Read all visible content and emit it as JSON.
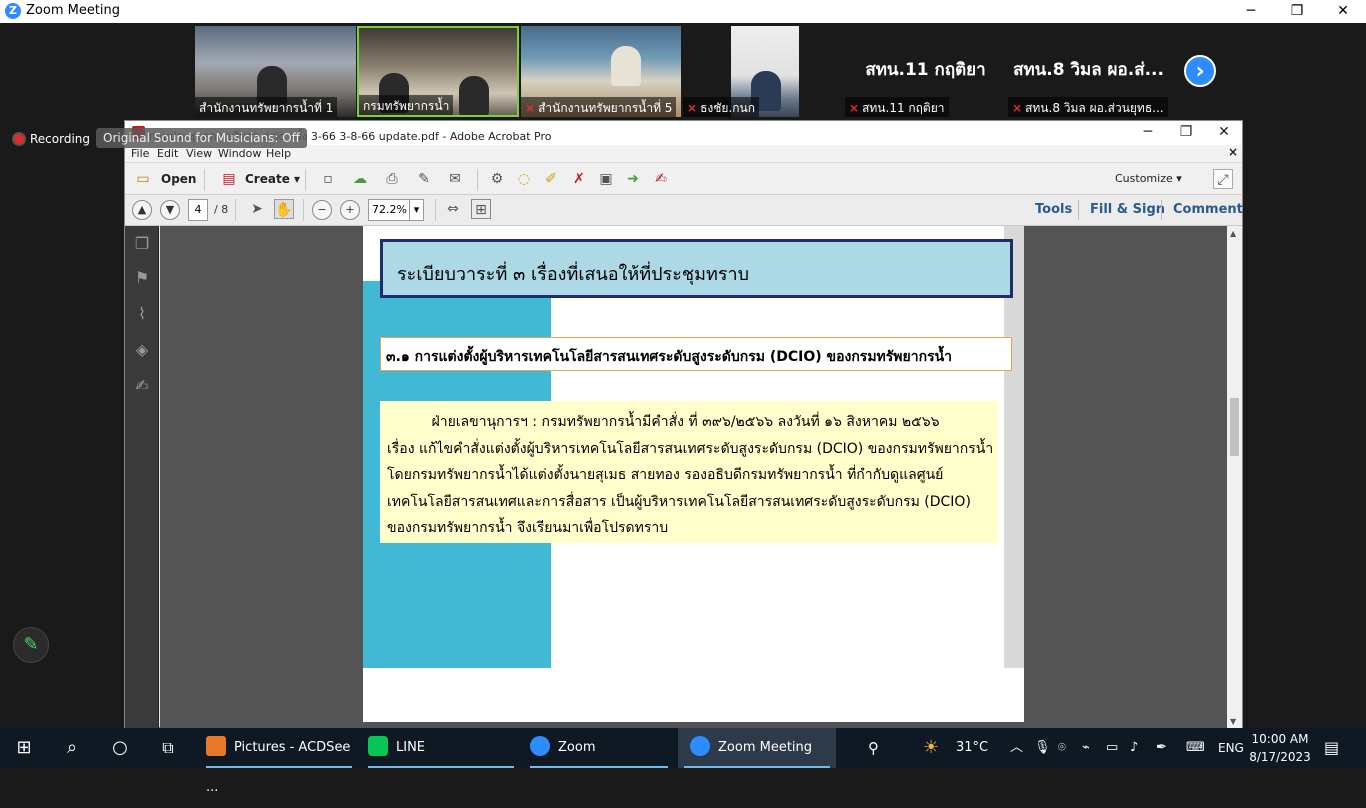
{
  "zoom": {
    "logo": "Z",
    "title": "Zoom Meeting",
    "minimize": "─",
    "maximize": "❐",
    "close": "✕",
    "recording": "Recording",
    "original_sound": "Original Sound for Musicians: Off",
    "next_arrow": "›",
    "pen": "✎",
    "mute_glyph": "⨯",
    "tiles": [
      {
        "name": "สำนักงานทรัพยากรน้ำที่ 1",
        "muted": false
      },
      {
        "name": "กรมทรัพยากรน้ำ",
        "muted": false
      },
      {
        "name": "สำนักงานทรัพยากรน้ำที่ 5",
        "muted": true
      },
      {
        "name": "ธงชัย.กนก",
        "muted": true
      },
      {
        "display": "สทน.11 กฤติยา",
        "name": "สทน.11 กฤติยา",
        "muted": true
      },
      {
        "display": "สทน.8 วิมล ผอ.ส่...",
        "name": "สทน.8 วิมล ผอ.ส่วนยุทธ...",
        "muted": true
      }
    ]
  },
  "acrobat": {
    "title": "กอบประชุมดกก.บริหาร dcio ครั้ง 3-66 3-8-66 update.pdf - Adobe Acrobat Pro",
    "menu": [
      "File",
      "Edit",
      "View",
      "Window",
      "Help"
    ],
    "close_doc": "×",
    "toolbar": {
      "open": "Open",
      "create": "Create",
      "customize": "Customize"
    },
    "nav": {
      "page_current": "4",
      "page_total": "/ 8",
      "zoom": "72.2%"
    },
    "right_links": [
      "Tools",
      "Fill & Sign",
      "Comment"
    ]
  },
  "document": {
    "title": "ระเบียบวาระที่ ๓   เรื่องที่เสนอให้ที่ประชุมทราบ",
    "subtitle": "๓.๑ การแต่งตั้งผู้บริหารเทคโนโลยีสารสนเทศระดับสูงระดับกรม (DCIO) ของกรมทรัพยากรน้ำ",
    "body_lines": [
      "          ฝ่ายเลขานุการฯ : กรมทรัพยากรน้ำมีคำสั่ง ที่ ๓๙๖/๒๕๖๖ ลงวันที่ ๑๖ สิงหาคม ๒๕๖๖",
      "เรื่อง แก้ไขคำสั่งแต่งตั้งผู้บริหารเทคโนโลยีสารสนเทศระดับสูงระดับกรม (DCIO) ของกรมทรัพยากรน้ำ",
      "โดยกรมทรัพยากรน้ำได้แต่งตั้งนายสุเมธ สายทอง รองอธิบดีกรมทรัพยากรน้ำ ที่กำกับดูแลศูนย์",
      "เทคโนโลยีสารสนเทศและการสื่อสาร เป็นผู้บริหารเทคโนโลยีสารสนเทศระดับสูงระดับกรม (DCIO)",
      "ของกรมทรัพยากรน้ำ จึงเรียนมาเพื่อโปรดทราบ"
    ]
  },
  "taskbar": {
    "apps": [
      {
        "label": "Pictures - ACDSee ...",
        "icon": "ACDSee-icon",
        "color": "#e8782a"
      },
      {
        "label": "LINE",
        "icon": "LINE-icon",
        "color": "#06c755"
      },
      {
        "label": "Zoom",
        "icon": "zoom-icon",
        "color": "#2d8cff"
      },
      {
        "label": "Zoom Meeting",
        "icon": "zoom-icon",
        "color": "#2d8cff"
      }
    ],
    "weather": "31°C",
    "lang": "ENG",
    "time": "10:00 AM",
    "date": "8/17/2023"
  }
}
